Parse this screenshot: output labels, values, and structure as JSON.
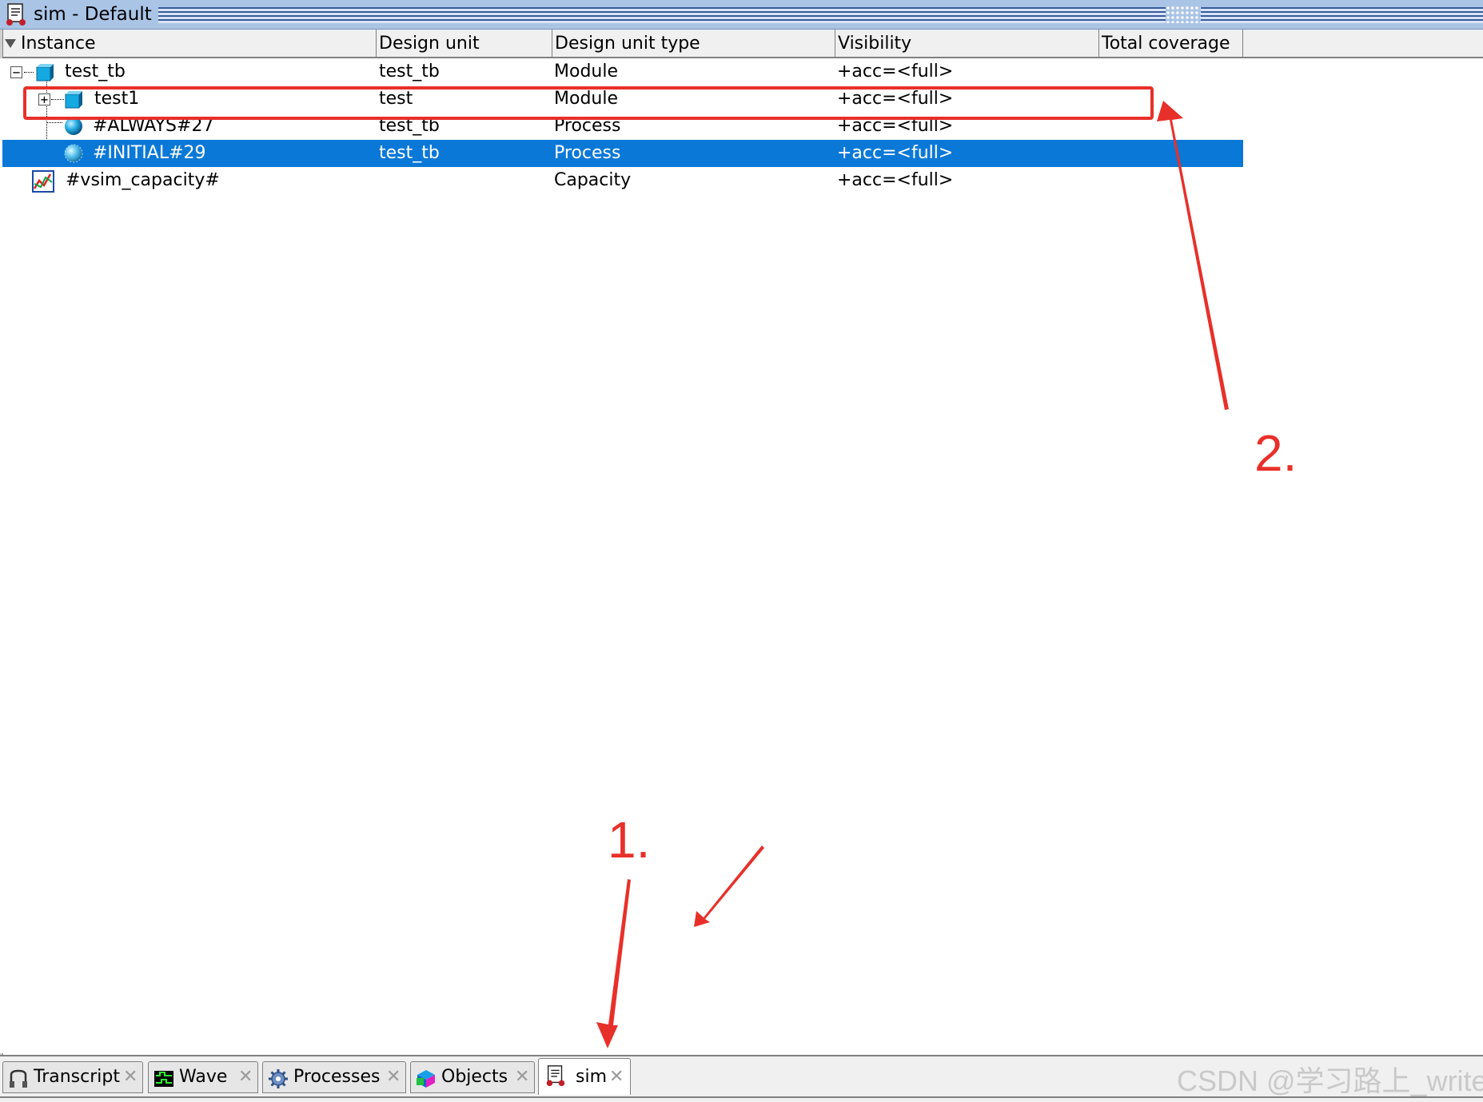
{
  "window": {
    "title": "sim - Default"
  },
  "columns": [
    {
      "label": "Instance"
    },
    {
      "label": "Design unit"
    },
    {
      "label": "Design unit type"
    },
    {
      "label": "Visibility"
    },
    {
      "label": "Total coverage"
    }
  ],
  "rows": [
    {
      "instance": "test_tb",
      "design_unit": "test_tb",
      "type": "Module",
      "visibility": "+acc=<full>",
      "icon": "module-icon",
      "expander": "−"
    },
    {
      "instance": "test1",
      "design_unit": "test",
      "type": "Module",
      "visibility": "+acc=<full>",
      "icon": "module-icon",
      "expander": "+"
    },
    {
      "instance": "#ALWAYS#27",
      "design_unit": "test_tb",
      "type": "Process",
      "visibility": "+acc=<full>",
      "icon": "process-icon"
    },
    {
      "instance": "#INITIAL#29",
      "design_unit": "test_tb",
      "type": "Process",
      "visibility": "+acc=<full>",
      "icon": "process-icon",
      "selected": true
    },
    {
      "instance": "#vsim_capacity#",
      "design_unit": "",
      "type": "Capacity",
      "visibility": "+acc=<full>",
      "icon": "capacity-icon"
    }
  ],
  "annotations": {
    "step1": "1.",
    "step2": "2.",
    "accent": "#e8302a"
  },
  "tabs": [
    {
      "label": "Transcript",
      "icon": "transcript-icon",
      "close": "✕"
    },
    {
      "label": "Wave",
      "icon": "wave-icon",
      "close": "✕"
    },
    {
      "label": "Processes",
      "icon": "gear-icon",
      "close": "✕"
    },
    {
      "label": "Objects",
      "icon": "objects-icon",
      "close": "✕"
    },
    {
      "label": "sim",
      "icon": "sim-icon",
      "close": "✕",
      "active": true
    }
  ],
  "watermark": "CSDN @学习路上_write",
  "colors": {
    "selection": "#0a78d7",
    "titlebar": "#aac4e6"
  }
}
